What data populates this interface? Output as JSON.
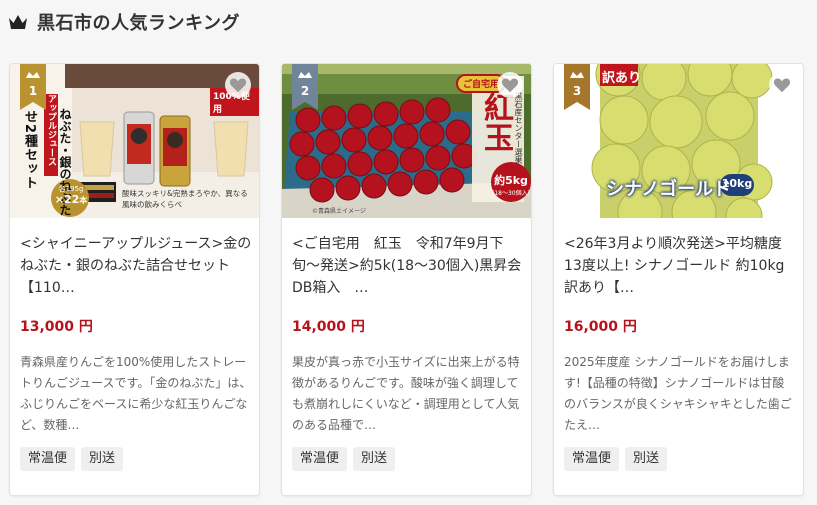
{
  "section": {
    "title": "黒石市の人気ランキング",
    "icon": "crown-icon"
  },
  "colors": {
    "gold": "#b8932f",
    "silver": "#708597",
    "bronze": "#a6762a",
    "price": "#b5121b"
  },
  "items": [
    {
      "rank": "1",
      "title": "<シャイニーアップルジュース>金のねぶた・銀のねぶた詰合せセット【110…",
      "price": "13,000 円",
      "description": "青森県産りんごを100%使用したストレートりんごジュースです。「金のねぶた」は、ふじりんごをベースに希少な紅玉りんごなど、数種…",
      "tags": [
        "常温便",
        "別送"
      ],
      "image": {
        "vertical_text": "ねぶた・銀のねぶた",
        "juice_label": "アップルジュース",
        "set_label": "せ2種セット",
        "badge": "100%使用",
        "count_prefix": "各195g",
        "count": "×22",
        "count_suffix": "本",
        "caption": "酸味スッキリ&完熟まろやか、異なる風味の飲みくらべ"
      }
    },
    {
      "rank": "2",
      "title": "<ご自宅用　紅玉　令和7年9月下旬〜発送>約5k(18〜30個入)黒昇会DB箱入　…",
      "price": "14,000 円",
      "description": "果皮が真っ赤で小玉サイズに出来上がる特徴があるりんごです。酸味が強く調理しても煮崩れしにくいなど・調理用として人気のある品種で…",
      "tags": [
        "常温便",
        "別送"
      ],
      "image": {
        "home_label": "ご自宅用",
        "variety": "紅玉",
        "side_label": "黒石産センター選果",
        "weight": "約5kg",
        "weight_sub": "(18〜30個入)",
        "credit": "©青森県土イメージ"
      }
    },
    {
      "rank": "3",
      "title": "<26年3月より順次発送>平均糖度13度以上! シナノゴールド 約10kg 訳あり【…",
      "price": "16,000 円",
      "description": "2025年度産 シナノゴールドをお届けします!【品種の特徴】シナノゴールドは甘酸のバランスが良くシャキシャキとした歯ごたえ…",
      "tags": [
        "常温便",
        "別送"
      ],
      "image": {
        "badge": "訳あり",
        "variety": "シナノゴールド",
        "weight": "10kg"
      }
    }
  ]
}
